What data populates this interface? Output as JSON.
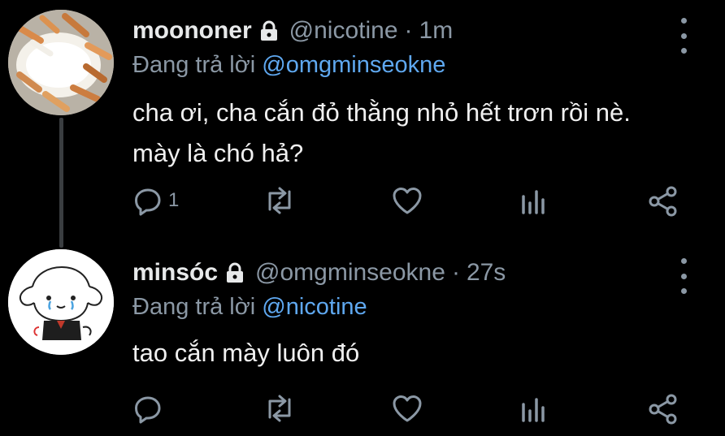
{
  "tweets": [
    {
      "author_name": "moononer",
      "handle": "@nicotine",
      "separator": "·",
      "time": "1m",
      "replying_prefix": "Đang trả lời",
      "replying_to": "@omgminseokne",
      "text_line1": "cha ơi, cha cắn đỏ thằng nhỏ hết trơn rồi nè.",
      "text_line2": "mày là chó hả?",
      "reply_count": "1"
    },
    {
      "author_name": "minsóc",
      "handle": "@omgminseokne",
      "separator": "·",
      "time": "27s",
      "replying_prefix": "Đang trả lời",
      "replying_to": "@nicotine",
      "text_line1": "tao cắn mày luôn đó",
      "reply_count": ""
    }
  ],
  "colors": {
    "background": "#000000",
    "text": "#e7e9ea",
    "muted": "#8b98a5",
    "mention": "#5fa8f0"
  },
  "icons": [
    "lock-icon",
    "reply-icon",
    "retweet-icon",
    "like-icon",
    "analytics-icon",
    "share-icon",
    "more-icon"
  ]
}
